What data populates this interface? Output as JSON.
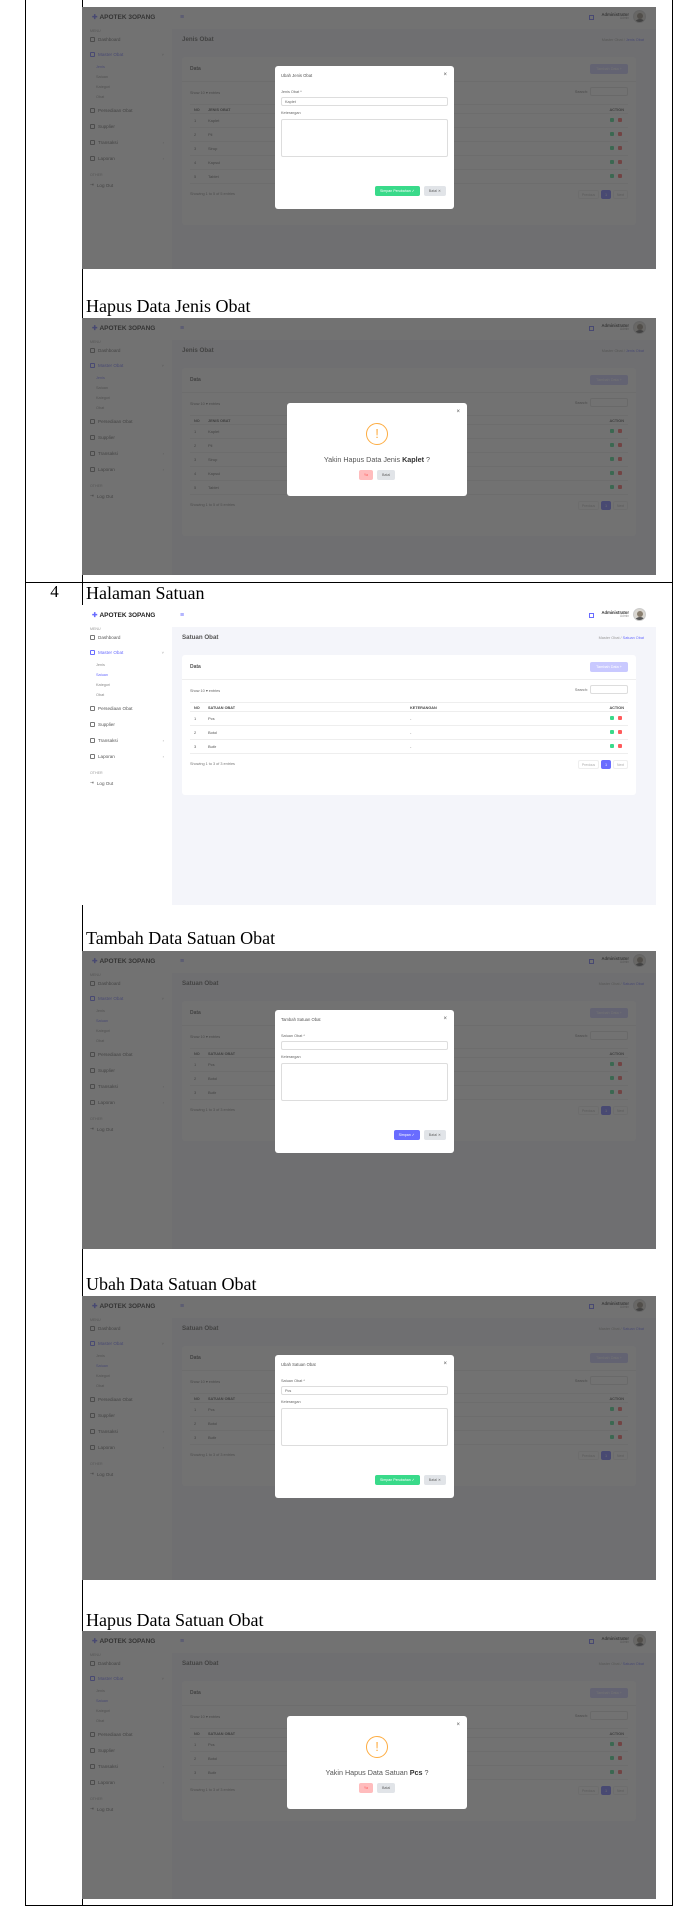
{
  "rows": [
    {
      "number": "4"
    }
  ],
  "captions": [
    "Hapus Data Jenis Obat",
    "Halaman Satuan",
    "Tambah Data Satuan Obat",
    "Ubah Data Satuan Obat",
    "Hapus Data Satuan Obat"
  ],
  "app": {
    "brand_mark": "✚",
    "brand": "APOTEK 3OPANG",
    "menu_label": "MENU",
    "other_label": "OTHER",
    "nav": {
      "dashboard": "Dashboard",
      "master_obat": "Master Obat",
      "sub": [
        "Jenis",
        "Satuan",
        "Kategori",
        "Obat"
      ],
      "persediaan": "Persediaan Obat",
      "supplier": "Supplier",
      "transaksi": "Transaksi",
      "laporan": "Laporan",
      "logout": "Log Out"
    },
    "user_name": "Administrator",
    "user_role": "Admin"
  },
  "jenis": {
    "title": "Jenis Obat",
    "crumb_parent": "Master Obat",
    "crumb_current": "Jenis Obat",
    "card_title": "Data",
    "add_button": "Tambah Data +",
    "show_entries": "Show  10  ▾  entries",
    "search_label": "Search:",
    "col_no": "NO",
    "col_name": "JENIS OBAT",
    "col_action": "ACTION",
    "rows": [
      {
        "no": "1",
        "name": "Kaplet"
      },
      {
        "no": "2",
        "name": "Pil"
      },
      {
        "no": "3",
        "name": "Sirup"
      },
      {
        "no": "4",
        "name": "Kapsul"
      },
      {
        "no": "5",
        "name": "Tablet"
      }
    ],
    "info": "Showing 1 to 5 of 5 entries",
    "edit_modal": {
      "title": "Ubah Jenis Obat",
      "field_label": "Jenis Obat *",
      "field_value": "Kaplet",
      "note_label": "Keterangan",
      "save": "Simpan Perubahan ✓",
      "cancel": "Batal ✕"
    },
    "delete_modal": {
      "prefix": "Yakin Hapus Data Jenis ",
      "item": "Kaplet",
      "suffix": " ?",
      "yes": "Ya",
      "no": "Batal"
    }
  },
  "satuan": {
    "title": "Satuan Obat",
    "crumb_parent": "Master Obat",
    "crumb_current": "Satuan Obat",
    "card_title": "Data",
    "add_button": "Tambah Data +",
    "show_entries": "Show  10  ▾  entries",
    "search_label": "Search:",
    "col_no": "NO",
    "col_name": "SATUAN OBAT",
    "col_note": "KETERANGAN",
    "col_action": "ACTION",
    "rows": [
      {
        "no": "1",
        "name": "Pcs",
        "note": "-"
      },
      {
        "no": "2",
        "name": "Botol",
        "note": "-"
      },
      {
        "no": "3",
        "name": "Butir",
        "note": "-"
      }
    ],
    "info": "Showing 1 to 3 of 3 entries",
    "pager": {
      "prev": "Previous",
      "page": "1",
      "next": "Next"
    },
    "add_modal": {
      "title": "Tambah Satuan Obat",
      "field_label": "Satuan Obat *",
      "note_label": "Keterangan",
      "save": "Simpan ✓",
      "cancel": "Batal ✕"
    },
    "edit_modal": {
      "title": "Ubah Satuan Obat",
      "field_label": "Satuan Obat *",
      "field_value": "Pcs",
      "note_label": "Keterangan",
      "save": "Simpan Perubahan ✓",
      "cancel": "Batal ✕"
    },
    "delete_modal": {
      "prefix": "Yakin Hapus Data Satuan ",
      "item": "Pcs",
      "suffix": " ?",
      "yes": "Ya",
      "no": "Batal"
    }
  },
  "colors": {
    "accent": "#696cff",
    "success": "#39da8a",
    "danger": "#ff5b5c",
    "warning": "#fdac41"
  }
}
